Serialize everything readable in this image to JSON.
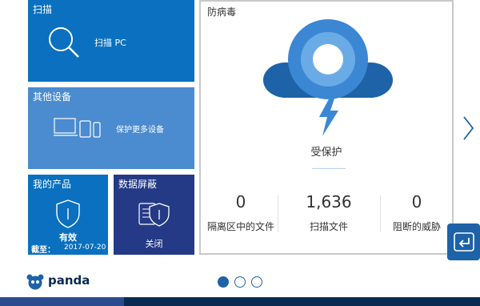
{
  "tiles": {
    "scan": {
      "title": "扫描",
      "action": "扫描 PC"
    },
    "other_devices": {
      "title": "其他设备",
      "action": "保护更多设备"
    },
    "products": {
      "title": "我的产品",
      "status": "有效",
      "expiry_label": "截至：",
      "expiry_date": "2017-07-20"
    },
    "privacy": {
      "title": "数据屏蔽",
      "status": "关闭"
    }
  },
  "antivirus": {
    "title": "防病毒",
    "status": "受保护",
    "stats": [
      {
        "value": "0",
        "label": "隔离区中的文件"
      },
      {
        "value": "1,636",
        "label": "扫描文件"
      },
      {
        "value": "0",
        "label": "阻断的威胁"
      }
    ]
  },
  "brand": {
    "name": "panda"
  },
  "pagination": {
    "pages": 3,
    "active": 0
  },
  "footer": {
    "partial_text": "▁▁ ▁▁ ▁ ▁▁ ▁"
  },
  "colors": {
    "tile_blue": "#0a70bf",
    "tile_light": "#4b8bd0",
    "tile_navy": "#243a86",
    "accent": "#1e62a8",
    "cloud": "#3b87d4"
  }
}
